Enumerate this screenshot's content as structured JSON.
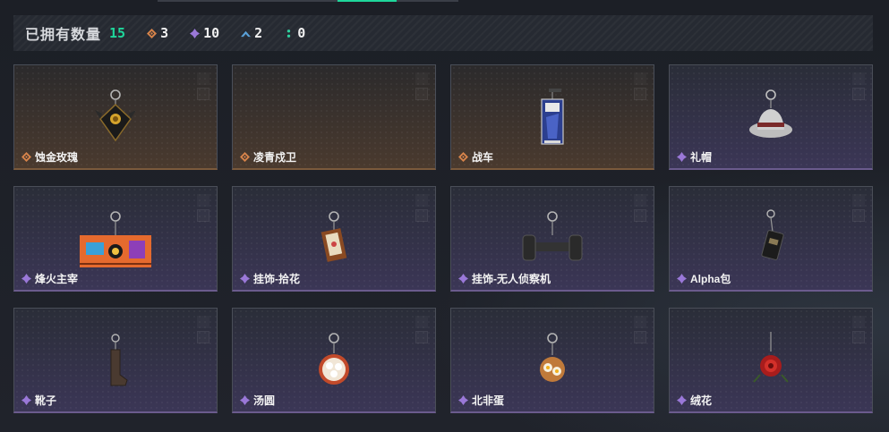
{
  "summary": {
    "label": "已拥有数量",
    "total": "15",
    "counts": [
      {
        "icon": "orange-diamond-icon",
        "color": "#d6834a",
        "value": "3"
      },
      {
        "icon": "purple-diamond-icon",
        "color": "#9a78d8",
        "value": "10"
      },
      {
        "icon": "blue-chevron-icon",
        "color": "#5aa0d8",
        "value": "2"
      },
      {
        "icon": "green-dots-icon",
        "color": "#2fd3a0",
        "value": "0"
      }
    ]
  },
  "colors": {
    "accent": "#1fd79b",
    "orange_rarity": "#d6834a",
    "purple_rarity": "#9a78d8"
  },
  "items": [
    {
      "name": "蚀金玫瑰",
      "rarity": "orange",
      "art": "gold-rose-pendant"
    },
    {
      "name": "凌青戍卫",
      "rarity": "orange",
      "art": "empty"
    },
    {
      "name": "战车",
      "rarity": "orange",
      "art": "chariot-card-pendant"
    },
    {
      "name": "礼帽",
      "rarity": "purple",
      "art": "top-hat-pendant"
    },
    {
      "name": "烽火主宰",
      "rarity": "purple",
      "art": "graffiti-container"
    },
    {
      "name": "挂饰-拾花",
      "rarity": "purple",
      "art": "picture-frame-pendant"
    },
    {
      "name": "挂饰-无人侦察机",
      "rarity": "purple",
      "art": "drone-pendant"
    },
    {
      "name": "Alpha包",
      "rarity": "purple",
      "art": "alpha-bag-pendant"
    },
    {
      "name": "靴子",
      "rarity": "purple",
      "art": "boot-pendant"
    },
    {
      "name": "汤圆",
      "rarity": "purple",
      "art": "tangyuan-bowl-pendant"
    },
    {
      "name": "北非蛋",
      "rarity": "purple",
      "art": "shakshuka-pan-pendant"
    },
    {
      "name": "绒花",
      "rarity": "purple",
      "art": "red-velvet-flower-pendant"
    }
  ]
}
